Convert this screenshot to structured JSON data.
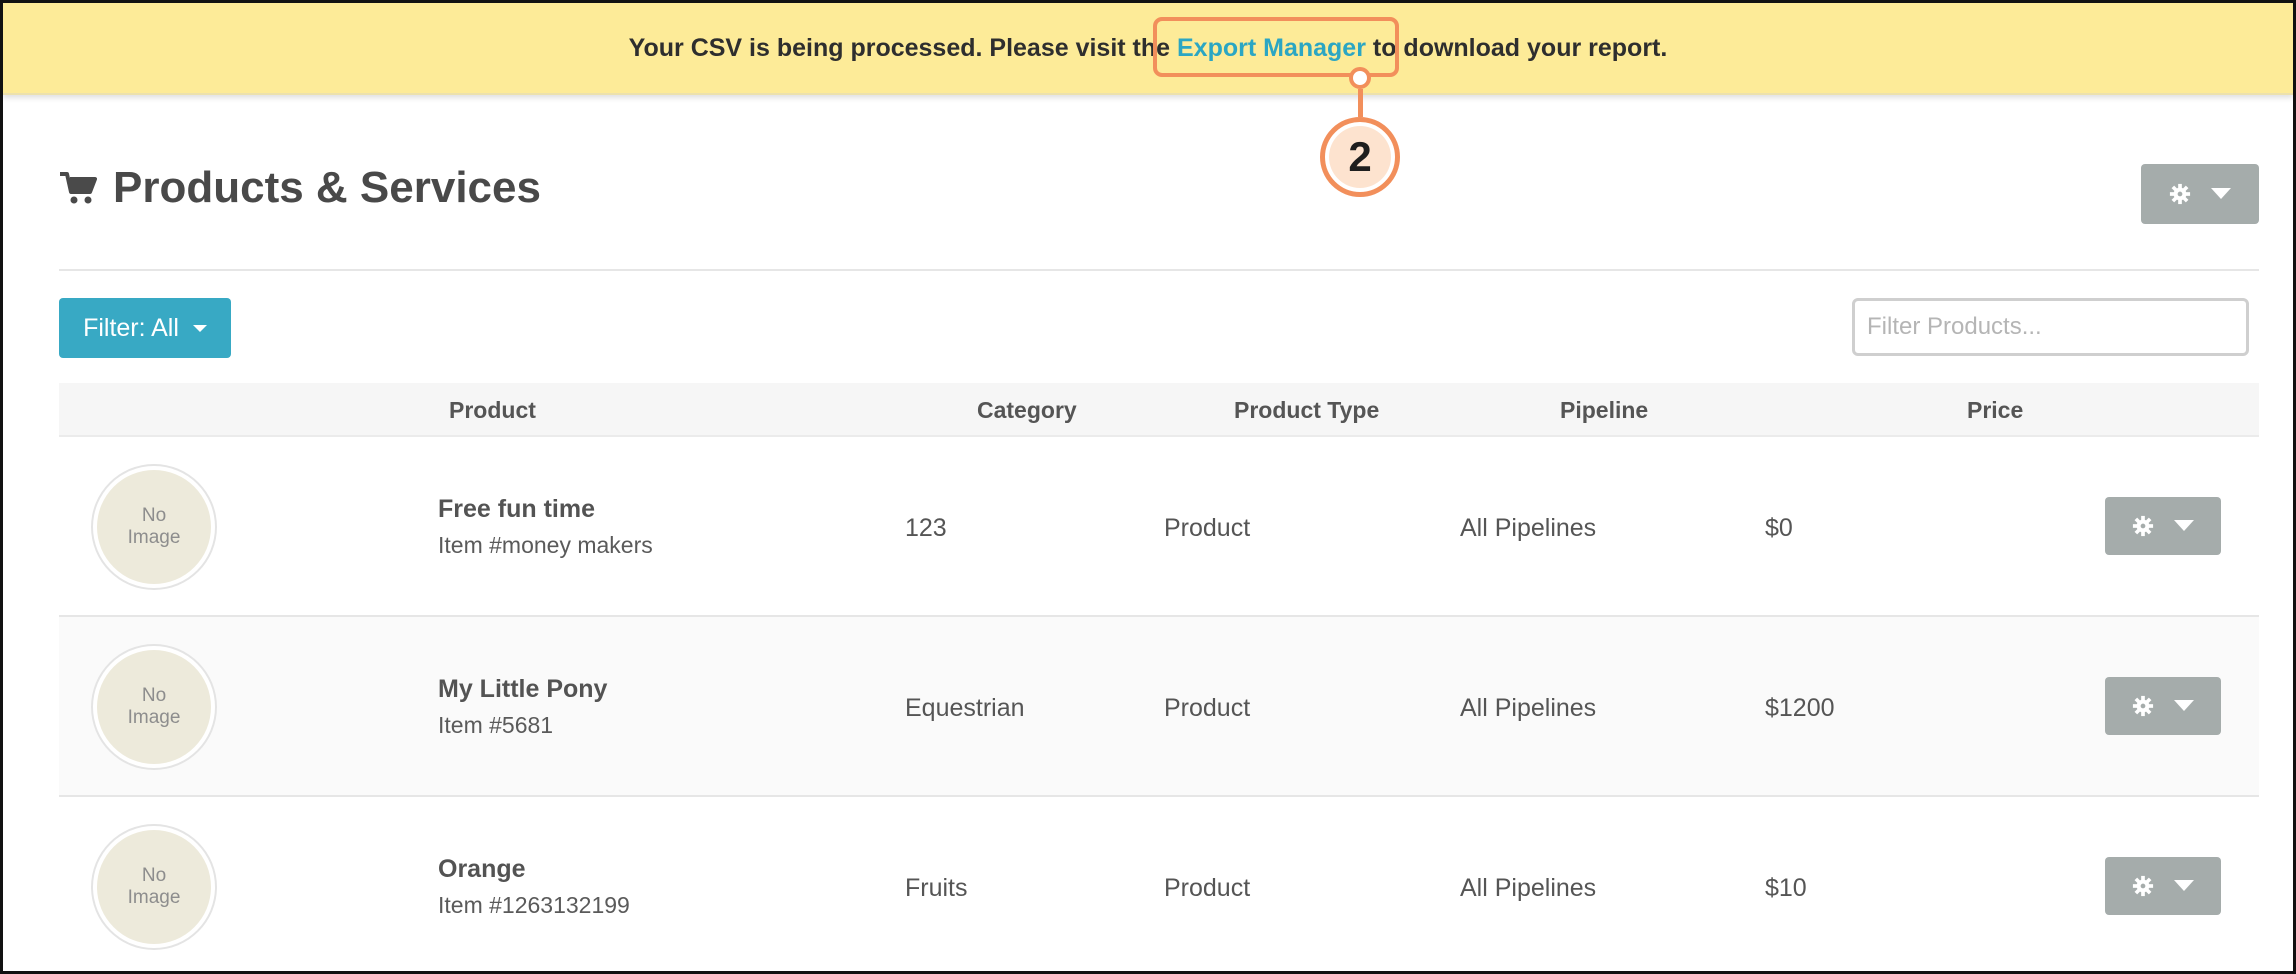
{
  "banner": {
    "text_before": "Your CSV is being processed. Please visit the ",
    "link_text": "Export Manager",
    "text_after": " to download your report."
  },
  "callout": {
    "number": "2"
  },
  "page": {
    "title": "Products & Services"
  },
  "toolbar": {
    "filter_label": "Filter: All",
    "search_placeholder": "Filter Products..."
  },
  "table": {
    "columns": [
      "Product",
      "Category",
      "Product Type",
      "Pipeline",
      "Price"
    ],
    "rows": [
      {
        "image_label": [
          "No",
          "Image"
        ],
        "name": "Free fun time",
        "item": "Item #money makers",
        "category": "123",
        "type": "Product",
        "pipeline": "All Pipelines",
        "price": "$0"
      },
      {
        "image_label": [
          "No",
          "Image"
        ],
        "name": "My Little Pony",
        "item": "Item #5681",
        "category": "Equestrian",
        "type": "Product",
        "pipeline": "All Pipelines",
        "price": "$1200"
      },
      {
        "image_label": [
          "No",
          "Image"
        ],
        "name": "Orange",
        "item": "Item #1263132199",
        "category": "Fruits",
        "type": "Product",
        "pipeline": "All Pipelines",
        "price": "$10"
      }
    ]
  },
  "icons": {
    "title": "cart-icon",
    "settings": "gear-icon",
    "dropdown": "caret-down-icon"
  },
  "colors": {
    "banner": "#fdeb98",
    "link": "#2ba6c3",
    "primary_button": "#38a9c4",
    "secondary_button": "#a5acab",
    "callout": "#f28f5b"
  }
}
